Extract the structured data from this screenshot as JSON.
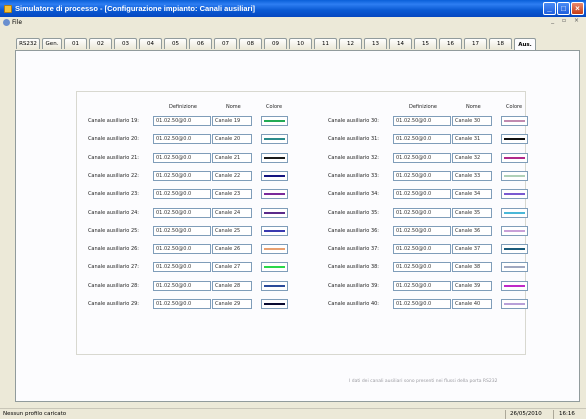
{
  "window": {
    "title": "Simulatore di processo - [Configurazione impianto: Canali ausiliari]"
  },
  "menu": {
    "file": "File"
  },
  "tabs": [
    "RS232",
    "Gen.",
    "01",
    "02",
    "03",
    "04",
    "05",
    "06",
    "07",
    "08",
    "09",
    "10",
    "11",
    "12",
    "13",
    "14",
    "15",
    "16",
    "17",
    "18",
    "Aus."
  ],
  "active_tab": "Aus.",
  "columns": {
    "definizione": "Definizione",
    "nome": "Nome",
    "colore": "Colore"
  },
  "left_rows": [
    {
      "label": "Canale ausiliario 19:",
      "definizione": "01.02.50@0.0",
      "nome": "Canale 19",
      "color": "#22aa55"
    },
    {
      "label": "Canale ausiliario 20:",
      "definizione": "01.02.50@0.0",
      "nome": "Canale 20",
      "color": "#2a8a8a"
    },
    {
      "label": "Canale ausiliario 21:",
      "definizione": "01.02.50@0.0",
      "nome": "Canale 21",
      "color": "#1a1a1a"
    },
    {
      "label": "Canale ausiliario 22:",
      "definizione": "01.02.50@0.0",
      "nome": "Canale 22",
      "color": "#141480"
    },
    {
      "label": "Canale ausiliario 23:",
      "definizione": "01.02.50@0.0",
      "nome": "Canale 23",
      "color": "#7a2a9a"
    },
    {
      "label": "Canale ausiliario 24:",
      "definizione": "01.02.50@0.0",
      "nome": "Canale 24",
      "color": "#5a2a8a"
    },
    {
      "label": "Canale ausiliario 25:",
      "definizione": "01.02.50@0.0",
      "nome": "Canale 25",
      "color": "#3a3ab0"
    },
    {
      "label": "Canale ausiliario 26:",
      "definizione": "01.02.50@0.0",
      "nome": "Canale 26",
      "color": "#e8a070"
    },
    {
      "label": "Canale ausiliario 27:",
      "definizione": "01.02.50@0.0",
      "nome": "Canale 27",
      "color": "#2ad84a"
    },
    {
      "label": "Canale ausiliario 28:",
      "definizione": "01.02.50@0.0",
      "nome": "Canale 28",
      "color": "#2a4a9a"
    },
    {
      "label": "Canale ausiliario 29:",
      "definizione": "01.02.50@0.0",
      "nome": "Canale 29",
      "color": "#0a0a30"
    }
  ],
  "right_rows": [
    {
      "label": "Canale ausiliario 30:",
      "definizione": "01.02.50@0.0",
      "nome": "Canale 30",
      "color": "#c08ab0"
    },
    {
      "label": "Canale ausiliario 31:",
      "definizione": "01.02.50@0.0",
      "nome": "Canale 31",
      "color": "#101010"
    },
    {
      "label": "Canale ausiliario 32:",
      "definizione": "01.02.50@0.0",
      "nome": "Canale 32",
      "color": "#b02a8a"
    },
    {
      "label": "Canale ausiliario 33:",
      "definizione": "01.02.50@0.0",
      "nome": "Canale 33",
      "color": "#b0d0b8"
    },
    {
      "label": "Canale ausiliario 34:",
      "definizione": "01.02.50@0.0",
      "nome": "Canale 34",
      "color": "#7a5ad0"
    },
    {
      "label": "Canale ausiliario 35:",
      "definizione": "01.02.50@0.0",
      "nome": "Canale 35",
      "color": "#4ab8d8"
    },
    {
      "label": "Canale ausiliario 36:",
      "definizione": "01.02.50@0.0",
      "nome": "Canale 36",
      "color": "#c8a0d8"
    },
    {
      "label": "Canale ausiliario 37:",
      "definizione": "01.02.50@0.0",
      "nome": "Canale 37",
      "color": "#1a5a7a"
    },
    {
      "label": "Canale ausiliario 38:",
      "definizione": "01.02.50@0.0",
      "nome": "Canale 38",
      "color": "#a0a8c0"
    },
    {
      "label": "Canale ausiliario 39:",
      "definizione": "01.02.50@0.0",
      "nome": "Canale 39",
      "color": "#c02ac8"
    },
    {
      "label": "Canale ausiliario 40:",
      "definizione": "01.02.50@0.0",
      "nome": "Canale 40",
      "color": "#b8a0d8"
    }
  ],
  "note": "I dati dei canali ausiliari sono presenti nei flussi della porta RS232",
  "status": {
    "left": "Nessun profilo caricato",
    "date": "26/05/2010",
    "time": "16:16"
  }
}
